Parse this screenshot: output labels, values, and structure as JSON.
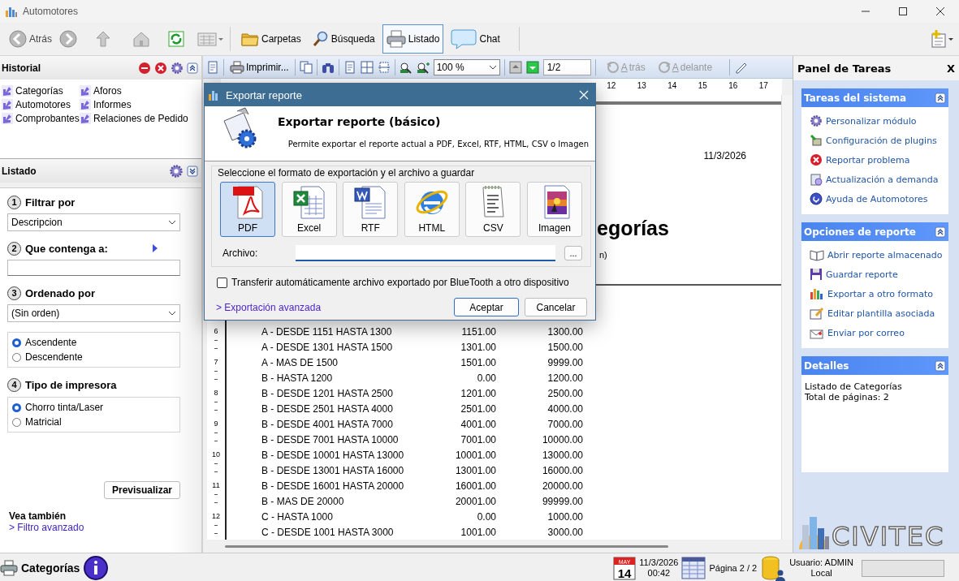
{
  "window": {
    "title": "Automotores"
  },
  "main_toolbar": {
    "back": {
      "label": "Atrás"
    },
    "views": [
      {
        "label": "Carpetas",
        "selected": false
      },
      {
        "label": "Búsqueda",
        "selected": false
      },
      {
        "label": "Listado",
        "selected": true
      },
      {
        "label": "Chat",
        "selected": false
      }
    ]
  },
  "historial": {
    "title": "Historial",
    "items": [
      "Categorías",
      "Automotores",
      "Comprobantes",
      "Aforos",
      "Informes",
      "Relaciones de Pedido"
    ]
  },
  "listado": {
    "title": "Listado",
    "steps": [
      {
        "number": "1",
        "label": "Filtrar por",
        "kind": "dropdown",
        "value": "Descripcion"
      },
      {
        "number": "2",
        "label": "Que contenga a:",
        "kind": "text"
      },
      {
        "number": "3",
        "label": "Ordenado por",
        "kind": "dropdown_radios",
        "value": "(Sin orden)",
        "options": [
          {
            "label": "Ascendente",
            "selected": true
          },
          {
            "label": "Descendente",
            "selected": false
          }
        ]
      },
      {
        "number": "4",
        "label": "Tipo de impresora",
        "kind": "radios",
        "options": [
          {
            "label": "Chorro tinta/Laser",
            "selected": true
          },
          {
            "label": "Matricial",
            "selected": false
          }
        ]
      }
    ],
    "preview_button": "Previsualizar",
    "see_also": {
      "title": "Vea también",
      "link": "> Filtro avanzado"
    }
  },
  "report_toolbar": {
    "print": "Imprimir...",
    "zoom": "100 %",
    "page": "1/2",
    "back": {
      "label": "Atrás",
      "disabled": true
    },
    "forward": {
      "label": "Adelante",
      "disabled": true
    }
  },
  "ruler_numbers": [
    "12",
    "13",
    "14",
    "15",
    "16",
    "17"
  ],
  "vertical_ruler": [
    "6",
    "7",
    "8",
    "9",
    "10",
    "11",
    "12"
  ],
  "report": {
    "date": "11/3/2026",
    "title_fragment": "egorías",
    "subtitle_fragment": "n)",
    "rows": [
      [
        "A - DESDE 1151 HASTA 1300",
        "1151.00",
        "1300.00"
      ],
      [
        "A - DESDE 1301 HASTA 1500",
        "1301.00",
        "1500.00"
      ],
      [
        "A - MAS DE 1500",
        "1501.00",
        "9999.00"
      ],
      [
        "B - HASTA 1200",
        "0.00",
        "1200.00"
      ],
      [
        "B - DESDE 1201 HASTA 2500",
        "1201.00",
        "2500.00"
      ],
      [
        "B - DESDE 2501 HASTA 4000",
        "2501.00",
        "4000.00"
      ],
      [
        "B - DESDE 4001 HASTA 7000",
        "4001.00",
        "7000.00"
      ],
      [
        "B - DESDE 7001 HASTA 10000",
        "7001.00",
        "10000.00"
      ],
      [
        "B - DESDE 10001 HASTA 13000",
        "10001.00",
        "13000.00"
      ],
      [
        "B - DESDE 13001 HASTA 16000",
        "13001.00",
        "16000.00"
      ],
      [
        "B - DESDE 16001 HASTA 20000",
        "16001.00",
        "20000.00"
      ],
      [
        "B - MAS DE 20000",
        "20001.00",
        "99999.00"
      ],
      [
        "C - HASTA 1000",
        "0.00",
        "1000.00"
      ],
      [
        "C - DESDE 1001 HASTA 3000",
        "1001.00",
        "3000.00"
      ]
    ]
  },
  "dialog": {
    "title": "Exportar reporte",
    "heading": "Exportar reporte (básico)",
    "description": "Permite exportar el reporte actual a PDF, Excel, RTF, HTML, CSV o Imagen",
    "group_label": "Seleccione el formato de exportación y el archivo a guardar",
    "formats": [
      {
        "label": "PDF",
        "selected": true
      },
      {
        "label": "Excel",
        "selected": false
      },
      {
        "label": "RTF",
        "selected": false
      },
      {
        "label": "HTML",
        "selected": false
      },
      {
        "label": "CSV",
        "selected": false
      },
      {
        "label": "Imagen",
        "selected": false
      }
    ],
    "file_label": "Archivo:",
    "browse_button": "...",
    "bluetooth": {
      "label": "Transferir automáticamente archivo exportado por BlueTooth a otro dispositivo",
      "checked": false
    },
    "advanced_link": "> Exportación avanzada",
    "buttons": [
      "Aceptar",
      "Cancelar"
    ]
  },
  "task_panel": {
    "title": "Panel de Tareas",
    "close": "X",
    "sections": [
      {
        "title": "Tareas del sistema",
        "kind": "links",
        "items": [
          "Personalizar módulo",
          "Configuración de plugins",
          "Reportar problema",
          "Actualización a demanda",
          "Ayuda de Automotores"
        ]
      },
      {
        "title": "Opciones de reporte",
        "kind": "links",
        "items": [
          "Abrir reporte almacenado",
          "Guardar reporte",
          "Exportar a otro formato",
          "Editar plantilla asociada",
          "Enviar por correo"
        ]
      },
      {
        "title": "Detalles",
        "kind": "text",
        "items": [
          "Listado de Categorías",
          "Total de páginas: 2"
        ]
      }
    ],
    "logo": "CIVITEC"
  },
  "status_bar": {
    "module": "Categorías",
    "calendar": {
      "month": "MAY",
      "day": "14"
    },
    "date": "11/3/2026",
    "time": "00:42",
    "page": "Página 2 / 2",
    "user": "Usuario: ADMIN",
    "location": "Local"
  }
}
